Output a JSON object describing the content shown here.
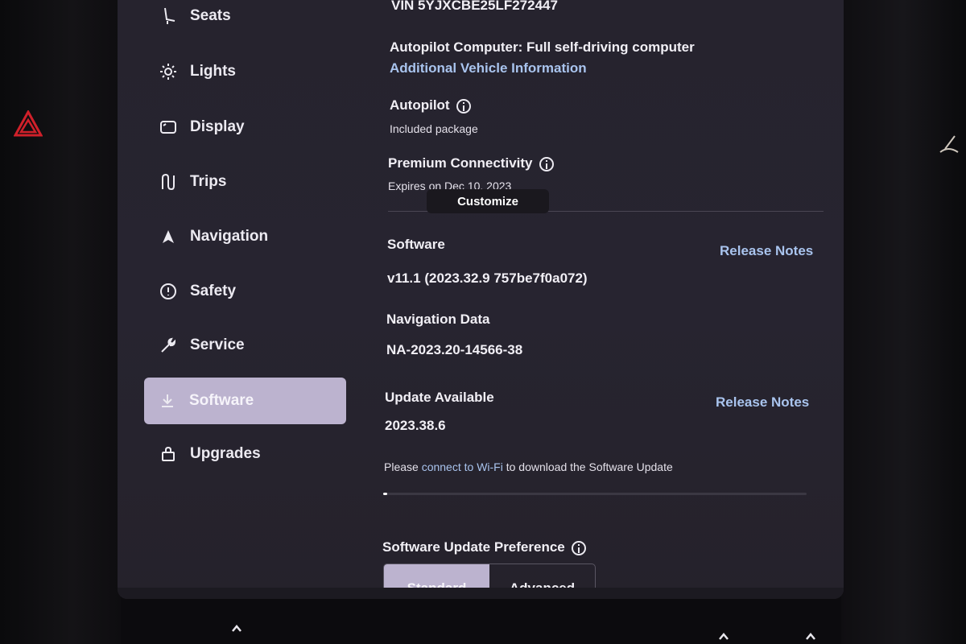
{
  "sidebar": {
    "items": [
      {
        "label": "Seats",
        "icon": "seat-icon"
      },
      {
        "label": "Lights",
        "icon": "sun-icon"
      },
      {
        "label": "Display",
        "icon": "display-icon"
      },
      {
        "label": "Trips",
        "icon": "trips-icon"
      },
      {
        "label": "Navigation",
        "icon": "navigation-arrow-icon"
      },
      {
        "label": "Safety",
        "icon": "alert-circle-icon"
      },
      {
        "label": "Service",
        "icon": "wrench-icon"
      },
      {
        "label": "Software",
        "icon": "download-icon",
        "active": true
      },
      {
        "label": "Upgrades",
        "icon": "bag-icon"
      }
    ]
  },
  "vehicle": {
    "vin": "VIN 5YJXCBE25LF272447",
    "autopilot_computer": "Autopilot Computer: Full self-driving computer",
    "additional_info_link": "Additional Vehicle Information",
    "autopilot_label": "Autopilot",
    "autopilot_value": "Included package",
    "connectivity_label": "Premium Connectivity",
    "connectivity_value": "Expires on Dec 10, 2023"
  },
  "tooltip": {
    "text": "Customize"
  },
  "software": {
    "label": "Software",
    "release_notes": "Release Notes",
    "version": "v11.1 (2023.32.9 757be7f0a072)",
    "nav_data_label": "Navigation Data",
    "nav_data_value": "NA-2023.20-14566-38",
    "update_label": "Update Available",
    "update_release_notes": "Release Notes",
    "update_version": "2023.38.6",
    "wifi_prefix": "Please",
    "wifi_link": "connect to Wi-Fi",
    "wifi_suffix": "to download the Software Update",
    "download_progress": 0.01,
    "preference_label": "Software Update Preference",
    "preference_options": [
      "Standard",
      "Advanced"
    ],
    "preference_selected": "Standard"
  },
  "colors": {
    "screen_bg": "#26232e",
    "accent_active": "#bcb3cf",
    "link": "#a9c4ee",
    "hazard": "#d0202a"
  }
}
